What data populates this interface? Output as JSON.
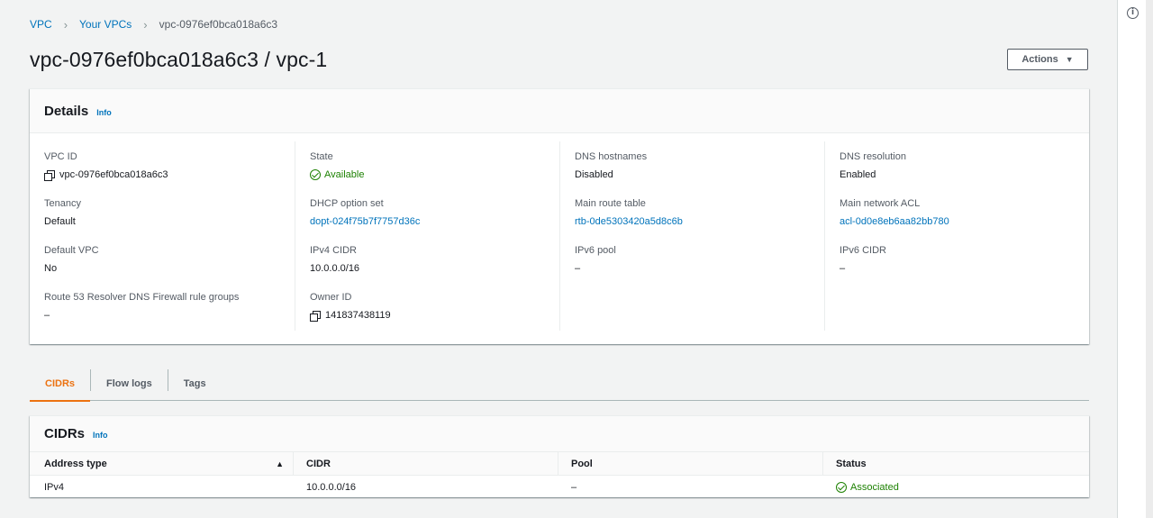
{
  "breadcrumb": {
    "items": [
      "VPC",
      "Your VPCs"
    ],
    "current": "vpc-0976ef0bca018a6c3"
  },
  "page_title": "vpc-0976ef0bca018a6c3 / vpc-1",
  "actions_label": "Actions",
  "details": {
    "title": "Details",
    "info": "Info",
    "fields": {
      "vpc_id": {
        "label": "VPC ID",
        "value": "vpc-0976ef0bca018a6c3"
      },
      "tenancy": {
        "label": "Tenancy",
        "value": "Default"
      },
      "default_vpc": {
        "label": "Default VPC",
        "value": "No"
      },
      "route53": {
        "label": "Route 53 Resolver DNS Firewall rule groups",
        "value": "–"
      },
      "state": {
        "label": "State",
        "value": "Available"
      },
      "dhcp": {
        "label": "DHCP option set",
        "value": "dopt-024f75b7f7757d36c"
      },
      "ipv4_cidr": {
        "label": "IPv4 CIDR",
        "value": "10.0.0.0/16"
      },
      "owner_id": {
        "label": "Owner ID",
        "value": "141837438119"
      },
      "dns_hostnames": {
        "label": "DNS hostnames",
        "value": "Disabled"
      },
      "main_route_table": {
        "label": "Main route table",
        "value": "rtb-0de5303420a5d8c6b"
      },
      "ipv6_pool": {
        "label": "IPv6 pool",
        "value": "–"
      },
      "dns_resolution": {
        "label": "DNS resolution",
        "value": "Enabled"
      },
      "main_acl": {
        "label": "Main network ACL",
        "value": "acl-0d0e8eb6aa82bb780"
      },
      "ipv6_cidr": {
        "label": "IPv6 CIDR",
        "value": "–"
      }
    }
  },
  "tabs": [
    {
      "label": "CIDRs",
      "active": true
    },
    {
      "label": "Flow logs",
      "active": false
    },
    {
      "label": "Tags",
      "active": false
    }
  ],
  "cidrs": {
    "title": "CIDRs",
    "info": "Info",
    "columns": [
      "Address type",
      "CIDR",
      "Pool",
      "Status"
    ],
    "rows": [
      {
        "address_type": "IPv4",
        "cidr": "10.0.0.0/16",
        "pool": "–",
        "status": "Associated"
      }
    ]
  },
  "colors": {
    "link": "#0073bb",
    "success": "#1d8102",
    "active_tab": "#ec7211"
  },
  "icons": [
    "copy-icon",
    "check-circle-icon",
    "sort-ascending-icon",
    "info-circle-icon",
    "caret-down-icon",
    "chevron-right-icon"
  ]
}
